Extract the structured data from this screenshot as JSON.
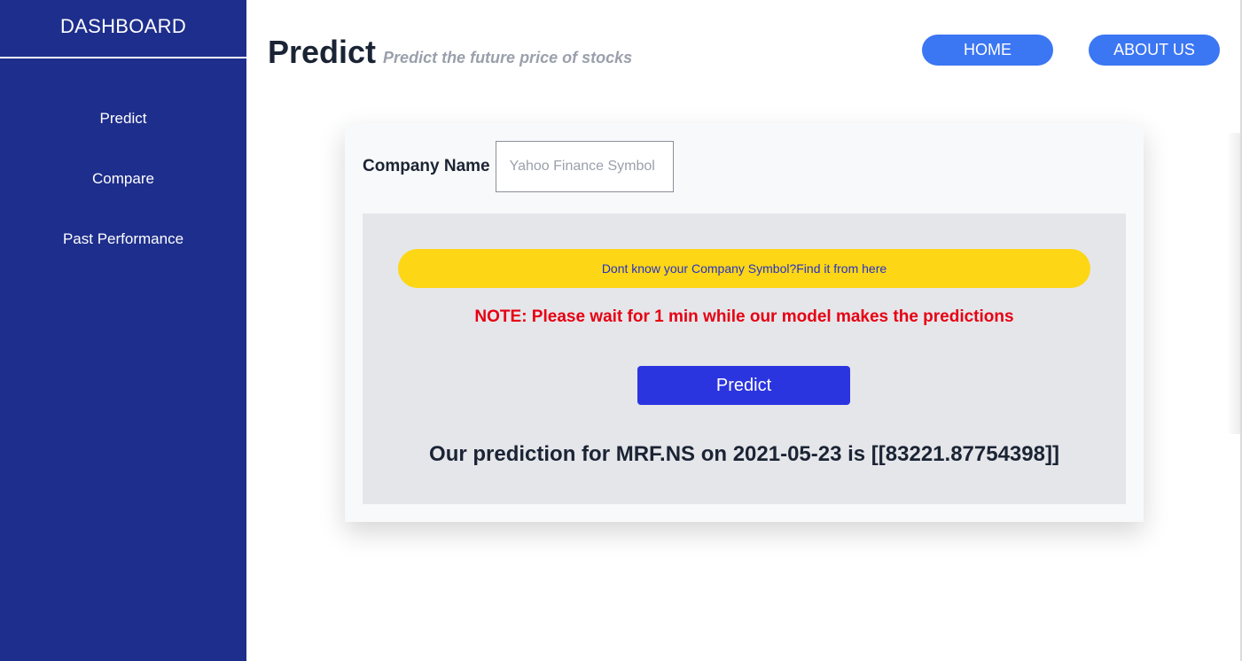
{
  "sidebar": {
    "title": "DASHBOARD",
    "items": [
      {
        "label": "Predict"
      },
      {
        "label": "Compare"
      },
      {
        "label": "Past Performance"
      }
    ]
  },
  "header": {
    "title": "Predict",
    "subtitle": "Predict the future price of stocks",
    "nav": {
      "home_label": "HOME",
      "about_label": "ABOUT US"
    }
  },
  "form": {
    "company_label": "Company Name",
    "company_input": {
      "value": "",
      "placeholder": "Yahoo Finance Symbol"
    },
    "symbol_link_text": "Dont know your Company Symbol?Find it from here",
    "note_text": "NOTE: Please wait for 1 min while our model makes the predictions",
    "predict_button_label": "Predict",
    "prediction_text": "Our prediction for MRF.NS on 2021-05-23 is [[83221.87754398]]"
  },
  "colors": {
    "sidebar_bg": "#1e2e8c",
    "nav_button": "#3b76f3",
    "predict_button": "#2b35df",
    "link_bar": "#fdd615",
    "note": "#e60012"
  }
}
